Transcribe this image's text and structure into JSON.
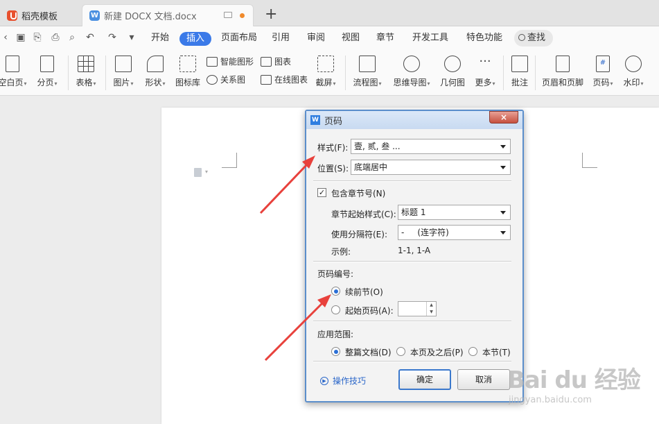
{
  "tabs": [
    {
      "label": "稻壳模板"
    },
    {
      "label": "新建 DOCX 文档.docx"
    }
  ],
  "menu": [
    "开始",
    "插入",
    "页面布局",
    "引用",
    "审阅",
    "视图",
    "章节",
    "开发工具",
    "特色功能"
  ],
  "menu_active": "插入",
  "search_label": "查找",
  "ribbon": {
    "blank_page": "空白页",
    "page_break": "分页",
    "table": "表格",
    "picture": "图片",
    "shape": "形状",
    "icon_lib": "图标库",
    "smart_shape": "智能图形",
    "chart": "图表",
    "relation_chart": "关系图",
    "online_chart": "在线图表",
    "screenshot": "截屏",
    "flowchart": "流程图",
    "mindmap": "思维导图",
    "geometry": "几何图",
    "more": "更多",
    "comment": "批注",
    "header_footer": "页眉和页脚",
    "page_number": "页码",
    "watermark": "水印"
  },
  "dialog": {
    "title": "页码",
    "close": "×",
    "style_label": "样式(F):",
    "style_value": "壹, 贰, 叁 ...",
    "position_label": "位置(S):",
    "position_value": "底端居中",
    "include_chapter": "包含章节号(N)",
    "chapter_style_label": "章节起始样式(C):",
    "chapter_style_value": "标题 1",
    "separator_label": "使用分隔符(E):",
    "separator_value": "-     (连字符)",
    "example_label": "示例:",
    "example_value": "1-1, 1-A",
    "numbering_title": "页码编号:",
    "continue_prev": "续前节(O)",
    "start_page": "起始页码(A):",
    "apply_title": "应用范围:",
    "whole_doc": "整篇文档(D)",
    "this_page_after": "本页及之后(P)",
    "this_section": "本节(T)",
    "tips": "操作技巧",
    "ok": "确定",
    "cancel": "取消"
  },
  "watermark": {
    "big": "Bai du 经验",
    "url": "jingyan.baidu.com"
  },
  "colors": {
    "accent": "#3b7ae8",
    "arrow": "#e8413c",
    "dialog_border": "#5b8ecb"
  }
}
